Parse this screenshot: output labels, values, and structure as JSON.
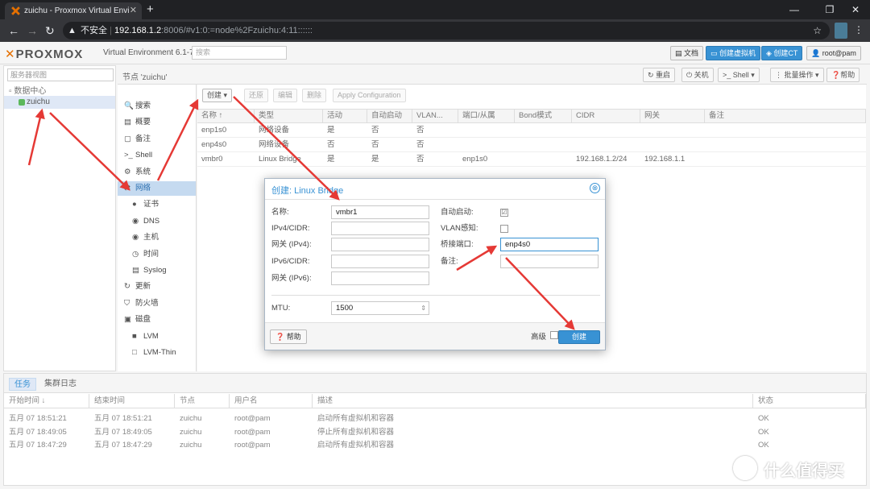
{
  "browser": {
    "tab_title": "zuichu - Proxmox Virtual Envi",
    "tab_close": "✕",
    "new_tab": "+",
    "url_insecure": "不安全",
    "url_host": "192.168.1.2",
    "url_rest": ":8006/#v1:0:=node%2Fzuichu:4:11::::::",
    "win_min": "—",
    "win_max": "❐",
    "win_close": "✕"
  },
  "header": {
    "logo_x": "✕",
    "logo": "PROXMOX",
    "version": "Virtual Environment 6.1-7",
    "search_placeholder": "搜索",
    "docs": "文档",
    "create_vm": "创建虚拟机",
    "create_ct": "创建CT",
    "user": "root@pam"
  },
  "tree": {
    "view_select": "服务器视图",
    "datacenter": "数据中心",
    "node": "zuichu"
  },
  "node_panel": {
    "title": "节点 'zuichu'",
    "toolbar": {
      "reboot": "重启",
      "shutdown": "关机",
      "shell": "Shell",
      "bulk": "批量操作",
      "help": "帮助"
    },
    "menu": [
      {
        "label": "搜索",
        "icon": "🔍"
      },
      {
        "label": "概要",
        "icon": "▤"
      },
      {
        "label": "备注",
        "icon": "▢"
      },
      {
        "label": "Shell",
        "icon": ">_"
      },
      {
        "label": "系统",
        "icon": "⚙"
      },
      {
        "label": "网络",
        "icon": "⇄"
      },
      {
        "label": "证书",
        "icon": "●"
      },
      {
        "label": "DNS",
        "icon": "◉"
      },
      {
        "label": "主机",
        "icon": "◉"
      },
      {
        "label": "时间",
        "icon": "◷"
      },
      {
        "label": "Syslog",
        "icon": "▤"
      },
      {
        "label": "更新",
        "icon": "↻"
      },
      {
        "label": "防火墙",
        "icon": "⛉"
      },
      {
        "label": "磁盘",
        "icon": "▣"
      },
      {
        "label": "LVM",
        "icon": "■"
      },
      {
        "label": "LVM-Thin",
        "icon": "□"
      }
    ]
  },
  "network": {
    "toolbar": {
      "create": "创建",
      "revert": "还原",
      "edit": "编辑",
      "remove": "删除",
      "apply": "Apply Configuration"
    },
    "columns": [
      "名称 ↑",
      "类型",
      "活动",
      "自动启动",
      "VLAN...",
      "端口/从属",
      "Bond模式",
      "CIDR",
      "网关",
      "备注"
    ],
    "rows": [
      [
        "enp1s0",
        "网络设备",
        "是",
        "否",
        "否",
        "",
        "",
        "",
        "",
        ""
      ],
      [
        "enp4s0",
        "网络设备",
        "否",
        "否",
        "否",
        "",
        "",
        "",
        "",
        ""
      ],
      [
        "vmbr0",
        "Linux Bridge",
        "是",
        "是",
        "否",
        "enp1s0",
        "",
        "192.168.1.2/24",
        "192.168.1.1",
        ""
      ]
    ]
  },
  "dialog": {
    "title": "创建: Linux Bridge",
    "close": "⊗",
    "name_label": "名称:",
    "name_value": "vmbr1",
    "ipv4_label": "IPv4/CIDR:",
    "gw4_label": "网关 (IPv4):",
    "ipv6_label": "IPv6/CIDR:",
    "gw6_label": "网关 (IPv6):",
    "autostart_label": "自动启动:",
    "autostart_check": "☑",
    "vlan_label": "VLAN感知:",
    "ports_label": "桥接端口:",
    "ports_value": "enp4s0",
    "comment_label": "备注:",
    "mtu_label": "MTU:",
    "mtu_value": "1500",
    "help": "帮助",
    "advanced": "高级",
    "create": "创建"
  },
  "log": {
    "tabs": [
      "任务",
      "集群日志"
    ],
    "columns": [
      "开始时间 ↓",
      "结束时间",
      "节点",
      "用户名",
      "描述",
      "状态"
    ],
    "rows": [
      [
        "五月 07 18:51:21",
        "五月 07 18:51:21",
        "zuichu",
        "root@pam",
        "启动所有虚拟机和容器",
        "OK"
      ],
      [
        "五月 07 18:49:05",
        "五月 07 18:49:05",
        "zuichu",
        "root@pam",
        "停止所有虚拟机和容器",
        "OK"
      ],
      [
        "五月 07 18:47:29",
        "五月 07 18:47:29",
        "zuichu",
        "root@pam",
        "启动所有虚拟机和容器",
        "OK"
      ]
    ]
  },
  "watermark": {
    "circle": "值",
    "text": "什么值得买"
  },
  "colors": {
    "accent": "#3892d4",
    "arrow": "#e53935",
    "chrome_dark": "#202124"
  }
}
